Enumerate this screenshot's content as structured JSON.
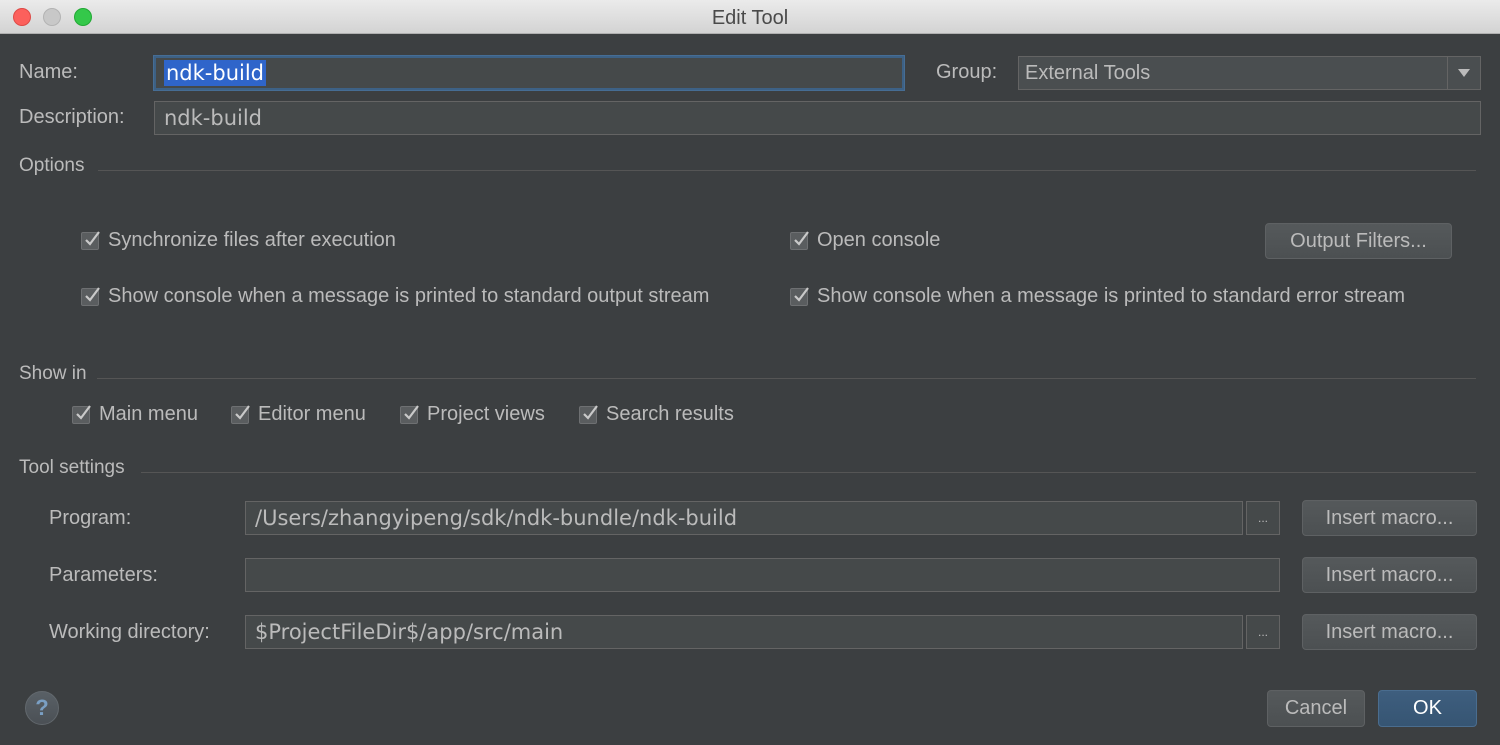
{
  "window": {
    "title": "Edit Tool"
  },
  "name": {
    "label": "Name:",
    "value": "ndk-build"
  },
  "group": {
    "label": "Group:",
    "value": "External Tools"
  },
  "description": {
    "label": "Description:",
    "value": "ndk-build"
  },
  "options": {
    "title": "Options",
    "sync_files": {
      "label": "Synchronize files after execution",
      "checked": true
    },
    "open_console": {
      "label": "Open console",
      "checked": true
    },
    "output_filters_label": "Output Filters...",
    "show_console_stdout": {
      "label": "Show console when a message is printed to standard output stream",
      "checked": true
    },
    "show_console_stderr": {
      "label": "Show console when a message is printed to standard error stream",
      "checked": true
    }
  },
  "show_in": {
    "title": "Show in",
    "items": [
      {
        "label": "Main menu",
        "checked": true
      },
      {
        "label": "Editor menu",
        "checked": true
      },
      {
        "label": "Project views",
        "checked": true
      },
      {
        "label": "Search results",
        "checked": true
      }
    ]
  },
  "tool_settings": {
    "title": "Tool settings",
    "program": {
      "label": "Program:",
      "value": "/Users/zhangyipeng/sdk/ndk-bundle/ndk-build"
    },
    "parameters": {
      "label": "Parameters:",
      "value": ""
    },
    "working_directory": {
      "label": "Working directory:",
      "value": "$ProjectFileDir$/app/src/main"
    },
    "insert_macro_label": "Insert macro...",
    "browse_label": "..."
  },
  "buttons": {
    "help": "?",
    "cancel": "Cancel",
    "ok": "OK"
  }
}
